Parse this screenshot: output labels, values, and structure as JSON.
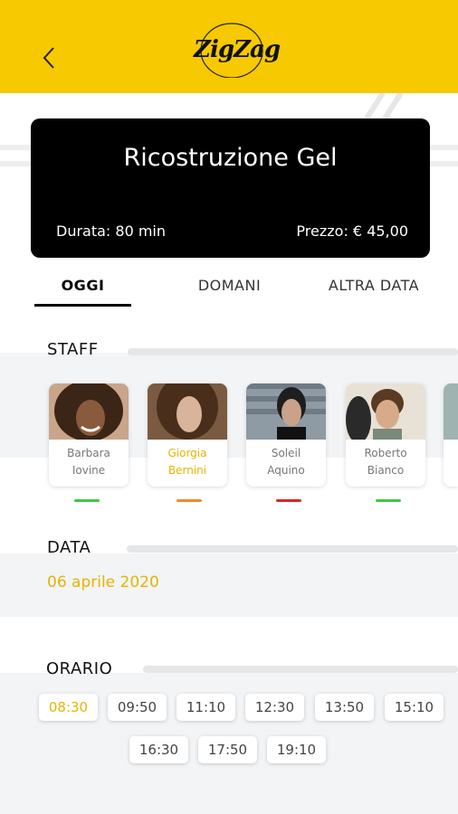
{
  "header": {
    "back_icon": "chevron-left-icon",
    "logo_text": "ZigZag",
    "accent_color": "#f6c900"
  },
  "service": {
    "title": "Ricostruzione Gel",
    "duration": "Durata: 80 min",
    "price": "Prezzo: € 45,00"
  },
  "tabs": [
    {
      "label": "OGGI",
      "active": true
    },
    {
      "label": "DOMANI",
      "active": false
    },
    {
      "label": "ALTRA DATA",
      "active": false
    }
  ],
  "staff": {
    "title": "STAFF",
    "members": [
      {
        "first": "Barbara",
        "last": "Iovine",
        "status_color": "#3ec93e",
        "selected": false
      },
      {
        "first": "Giorgia",
        "last": "Bernini",
        "status_color": "#f08a2a",
        "selected": true
      },
      {
        "first": "Soleil",
        "last": "Aquino",
        "status_color": "#e02424",
        "selected": false
      },
      {
        "first": "Roberto",
        "last": "Bianco",
        "status_color": "#3ec93e",
        "selected": false
      }
    ]
  },
  "date_section": {
    "title": "DATA",
    "value": "06 aprile 2020",
    "value_color": "#e8b300"
  },
  "time_section": {
    "title": "ORARIO",
    "slots": [
      "08:30",
      "09:50",
      "11:10",
      "12:30",
      "13:50",
      "15:10",
      "16:30",
      "17:50",
      "19:10"
    ],
    "selected": "08:30"
  }
}
